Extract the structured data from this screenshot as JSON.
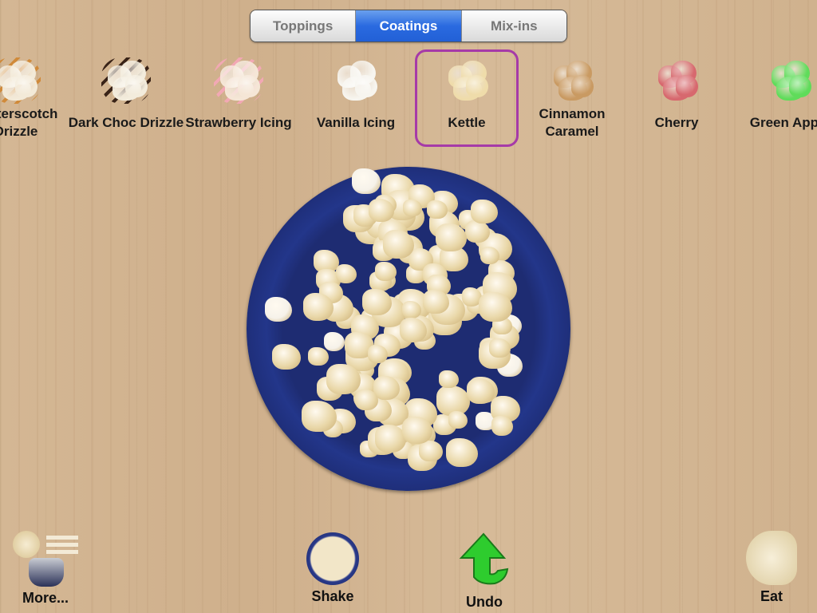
{
  "tabs": [
    {
      "label": "Toppings",
      "selected": false
    },
    {
      "label": "Coatings",
      "selected": true
    },
    {
      "label": "Mix-ins",
      "selected": false
    }
  ],
  "flavors": [
    {
      "label": "Butterscotch Drizzle",
      "color": "#f3ead8",
      "stripe": "#d08a3a"
    },
    {
      "label": "Dark Choc Drizzle",
      "color": "#f3ecdc",
      "stripe": "#3a2418"
    },
    {
      "label": "Strawberry Icing",
      "color": "#f5e6d6",
      "stripe": "#f2a8b4"
    },
    {
      "label": "Vanilla Icing",
      "color": "#f7f5ef",
      "stripe": ""
    },
    {
      "label": "Kettle",
      "color": "#efdcaa",
      "stripe": "",
      "selected": true
    },
    {
      "label": "Cinnamon Caramel",
      "color": "#c99a62",
      "stripe": ""
    },
    {
      "label": "Cherry",
      "color": "#d7686e",
      "stripe": ""
    },
    {
      "label": "Green Apple",
      "color": "#5fdc5a",
      "stripe": ""
    }
  ],
  "plate": {
    "popcorn_color": "#e9d7a8",
    "plain_color": "#f6f2ea",
    "rim_color": "#1e2c72"
  },
  "bottom": {
    "more": "More...",
    "shake": "Shake",
    "undo": "Undo",
    "eat": "Eat"
  },
  "colors": {
    "accent": "#2a6ae0",
    "selection": "#a63aa8",
    "undo_arrow": "#2ecc2e"
  }
}
